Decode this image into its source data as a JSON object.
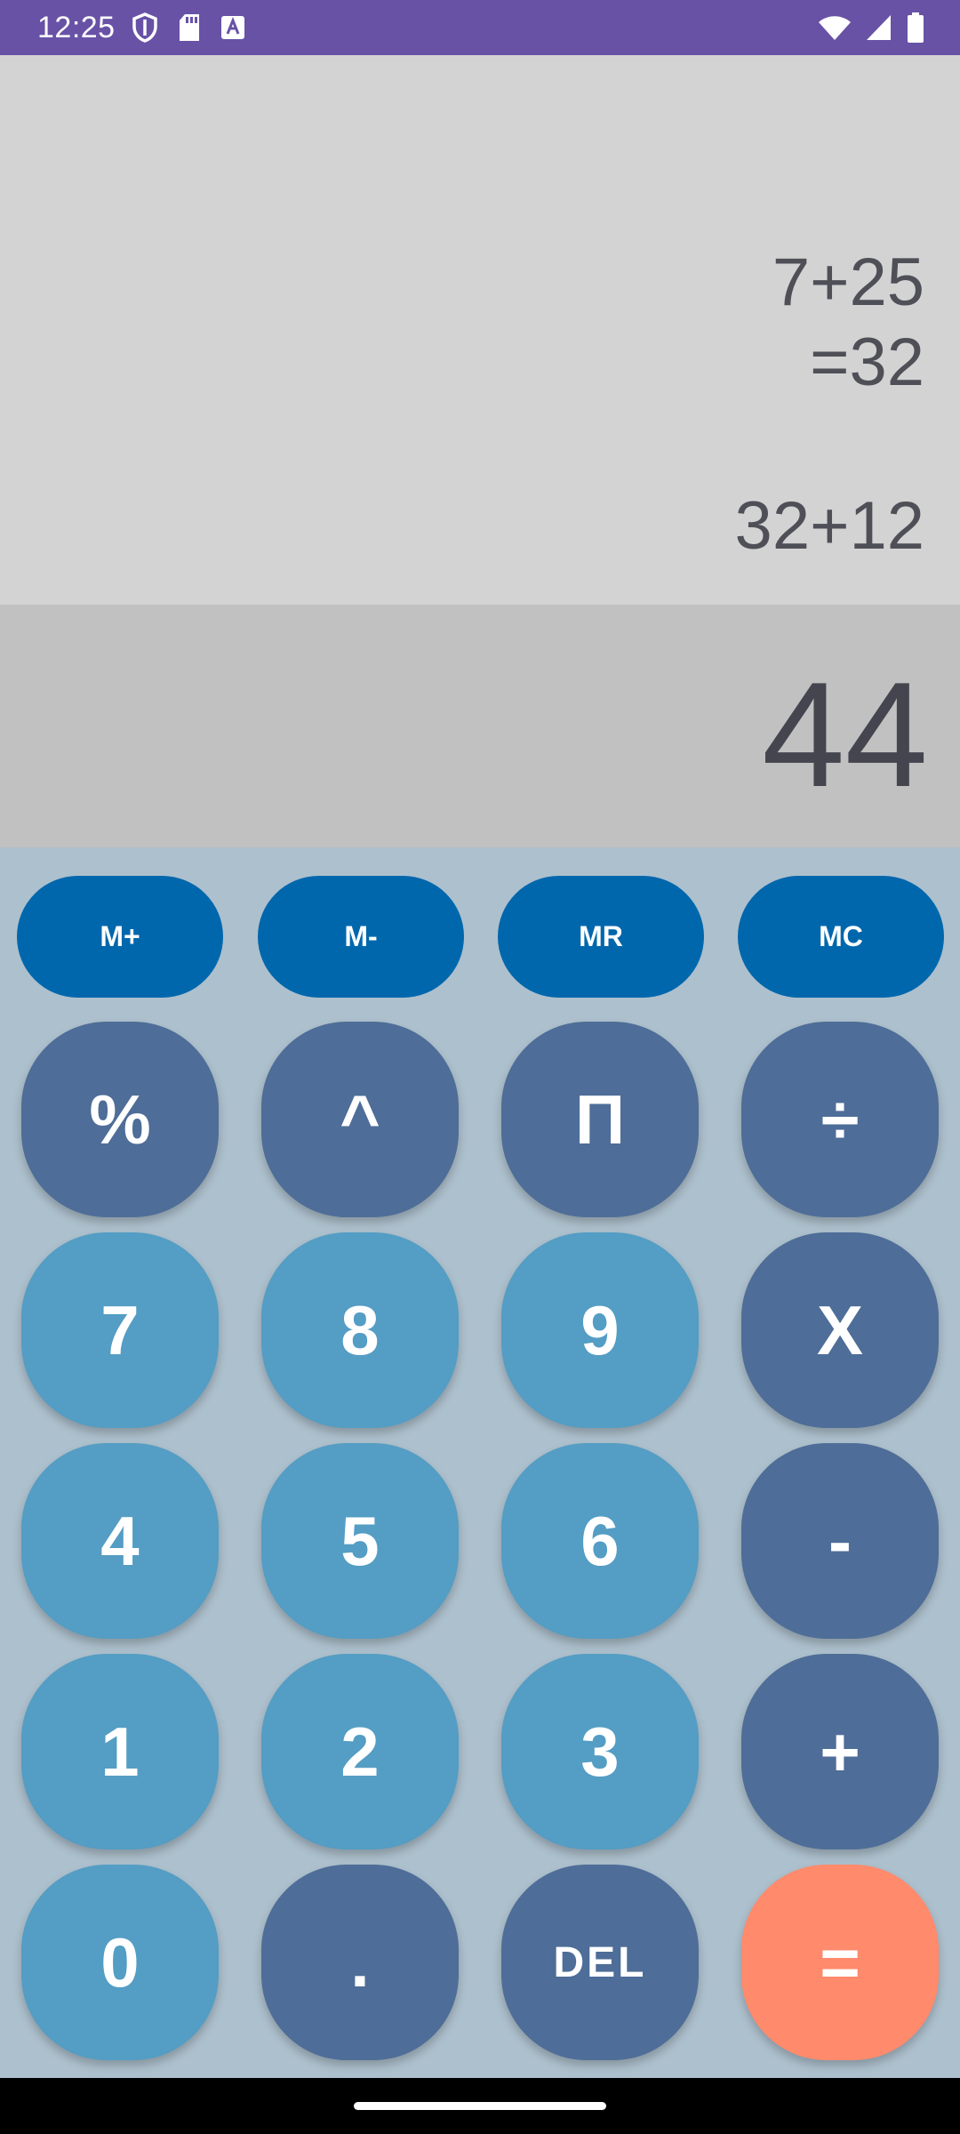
{
  "status_bar": {
    "time": "12:25",
    "icons_left": [
      "shield-icon",
      "sd-card-icon",
      "keyboard-a-icon"
    ],
    "icons_right": [
      "wifi-icon",
      "cell-signal-icon",
      "battery-icon"
    ],
    "color": "#6852a6"
  },
  "history": {
    "lines": [
      "7+25",
      "=32",
      "32+12"
    ]
  },
  "display": {
    "result": "44"
  },
  "memory_buttons": [
    "M+",
    "M-",
    "MR",
    "MC"
  ],
  "keys": {
    "percent": "%",
    "power": "^",
    "pi": "Π",
    "divide": "÷",
    "seven": "7",
    "eight": "8",
    "nine": "9",
    "multiply": "X",
    "four": "4",
    "five": "5",
    "six": "6",
    "minus": "-",
    "one": "1",
    "two": "2",
    "three": "3",
    "plus": "+",
    "zero": "0",
    "dot": ".",
    "del": "DEL",
    "equals": "="
  },
  "colors": {
    "memory_button": "#0167ad",
    "operator_key": "#4e6d98",
    "digit_key": "#549dc4",
    "equals_key": "#ff8a6c",
    "keypad_background": "#adc0cd"
  }
}
